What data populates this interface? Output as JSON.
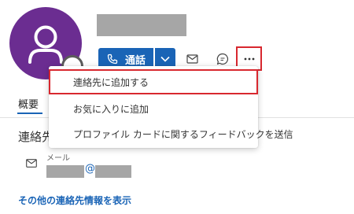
{
  "header": {
    "call_label": "通話"
  },
  "tabs": [
    {
      "label": "概要"
    }
  ],
  "contact": {
    "section_title": "連絡先",
    "email_label": "メール",
    "at_sign": "@",
    "more_info_link": "その他の連絡先情報を表示"
  },
  "menu": {
    "items": [
      {
        "label": "連絡先に追加する"
      },
      {
        "label": "お気に入りに追加"
      },
      {
        "label": "プロファイル カードに関するフィードバックを送信"
      }
    ]
  },
  "colors": {
    "avatar_bg": "#6b2d91",
    "accent": "#1a64b6",
    "highlight": "#d8282f",
    "redaction": "#a6a6a6"
  },
  "icons": [
    "person-icon",
    "presence-icon",
    "phone-icon",
    "chevron-down-icon",
    "mail-icon",
    "chat-icon",
    "more-icon"
  ]
}
